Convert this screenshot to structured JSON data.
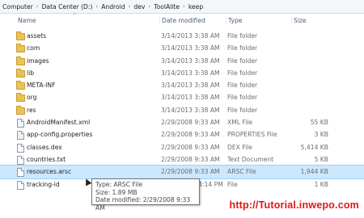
{
  "breadcrumb": [
    "Computer",
    "Data Center (D:)",
    "Android",
    "dev",
    "ToolAlite",
    "keep"
  ],
  "columns": {
    "name": "Name",
    "date": "Date modified",
    "type": "Type",
    "size": "Size"
  },
  "files": [
    {
      "name": "assets",
      "date": "3/14/2013 3:38 AM",
      "type": "File folder",
      "size": "",
      "icon": "folder-icon"
    },
    {
      "name": "com",
      "date": "3/14/2013 3:38 AM",
      "type": "File folder",
      "size": "",
      "icon": "folder-icon"
    },
    {
      "name": "images",
      "date": "3/14/2013 3:38 AM",
      "type": "File folder",
      "size": "",
      "icon": "folder-icon"
    },
    {
      "name": "lib",
      "date": "3/14/2013 3:38 AM",
      "type": "File folder",
      "size": "",
      "icon": "folder-icon"
    },
    {
      "name": "META-INF",
      "date": "3/14/2013 3:38 AM",
      "type": "File folder",
      "size": "",
      "icon": "folder-icon"
    },
    {
      "name": "org",
      "date": "3/14/2013 3:38 AM",
      "type": "File folder",
      "size": "",
      "icon": "folder-icon"
    },
    {
      "name": "res",
      "date": "3/14/2013 3:38 AM",
      "type": "File folder",
      "size": "",
      "icon": "folder-icon"
    },
    {
      "name": "AndroidManifest.xml",
      "date": "2/29/2008 9:33 AM",
      "type": "XML File",
      "size": "55 KB",
      "icon": "xml-file-icon"
    },
    {
      "name": "app-config.properties",
      "date": "2/29/2008 9:33 AM",
      "type": "PROPERTIES File",
      "size": "3 KB",
      "icon": "properties-file-icon"
    },
    {
      "name": "classes.dex",
      "date": "2/29/2008 9:33 AM",
      "type": "DEX File",
      "size": "5,414 KB",
      "icon": "dex-file-icon"
    },
    {
      "name": "countries.txt",
      "date": "2/29/2008 9:33 AM",
      "type": "Text Document",
      "size": "5 KB",
      "icon": "text-file-icon"
    },
    {
      "name": "resources.arsc",
      "date": "2/29/2008 9:33 AM",
      "type": "ARSC File",
      "size": "1,944 KB",
      "icon": "arsc-file-icon",
      "selected": true
    },
    {
      "name": "tracking-id",
      "date": "11/29/2013 4:14 PM",
      "type": "File",
      "size": "1 KB",
      "icon": "file-icon"
    }
  ],
  "tooltip": {
    "type": "Type: ARSC File",
    "size": "Size: 1.89 MB",
    "date": "Date modified: 2/29/2008 9:33 AM"
  },
  "watermark": "http://Tutorial.inwepo.com"
}
